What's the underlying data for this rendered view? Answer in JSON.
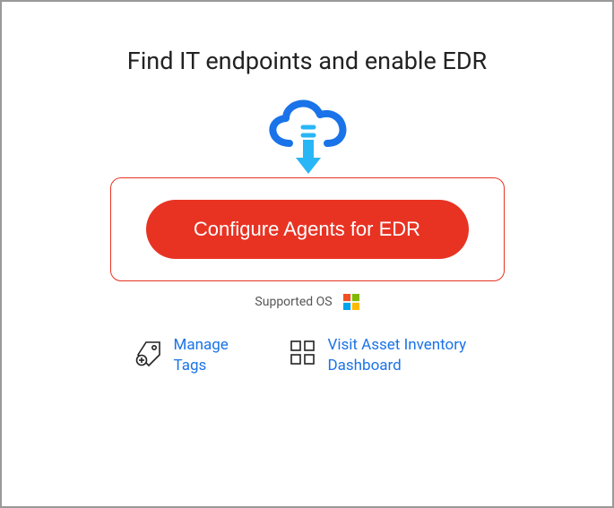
{
  "header": {
    "title": "Find IT endpoints and enable EDR"
  },
  "mainAction": {
    "buttonLabel": "Configure Agents for EDR"
  },
  "supported": {
    "label": "Supported OS",
    "osIcon": "windows-icon"
  },
  "links": [
    {
      "icon": "tag-plus-icon",
      "label": "Manage Tags"
    },
    {
      "icon": "dashboard-icon",
      "label": "Visit Asset Inventory Dashboard"
    }
  ]
}
